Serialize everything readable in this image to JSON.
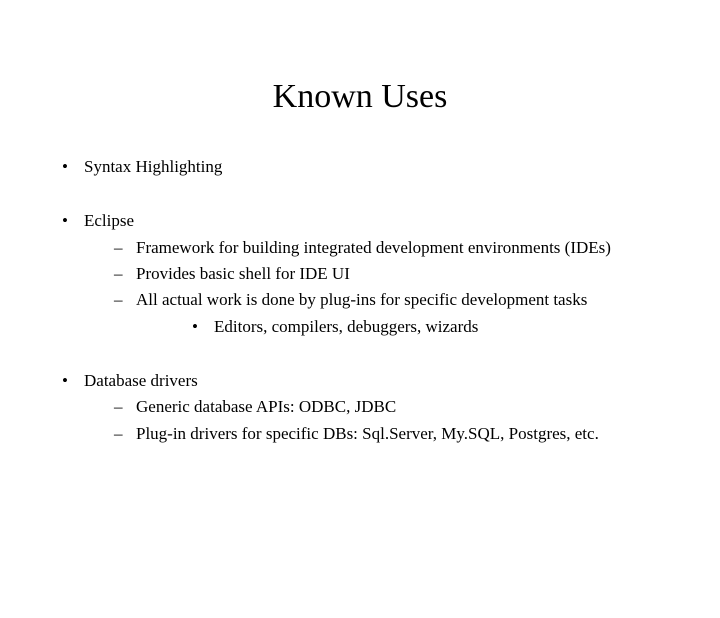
{
  "title": "Known Uses",
  "groups": [
    {
      "item": "Syntax Highlighting",
      "subs": []
    },
    {
      "item": "Eclipse",
      "subs": [
        {
          "text": "Framework for building integrated development environments (IDEs)"
        },
        {
          "text": "Provides basic shell for IDE UI"
        },
        {
          "text": "All actual work is done by plug-ins for specific development tasks",
          "subsubs": [
            "Editors, compilers, debuggers, wizards"
          ]
        }
      ]
    },
    {
      "item": "Database drivers",
      "subs": [
        {
          "text": "Generic database APIs: ODBC, JDBC"
        },
        {
          "text": "Plug-in drivers for specific DBs: Sql.Server, My.SQL, Postgres, etc."
        }
      ]
    }
  ]
}
